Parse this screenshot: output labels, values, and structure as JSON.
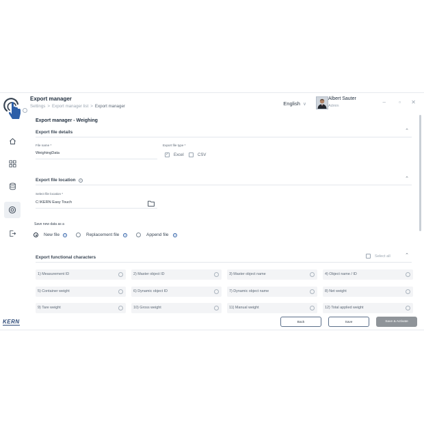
{
  "header": {
    "title": "Export manager",
    "breadcrumbs": [
      "Settings",
      "Export manager list",
      "Export manager"
    ],
    "language": "English",
    "user_name": "Albert Sauter",
    "user_role": "Admin"
  },
  "sidebar": {
    "brand": "KERN",
    "items": [
      "home-icon",
      "grid-icon",
      "database-icon",
      "settings-icon",
      "logout-icon"
    ],
    "active_item": "settings-icon"
  },
  "page": {
    "title": "Export manager - Weighing"
  },
  "file_details": {
    "title": "Export file details",
    "name_label": "File name *",
    "name_value": "WeighingData",
    "type_label": "Export file type *",
    "options": [
      {
        "label": "Excel",
        "checked": true
      },
      {
        "label": "CSV",
        "checked": false
      }
    ]
  },
  "file_location": {
    "title": "Export file location",
    "select_label": "Select file location *",
    "path_value": "C:\\KERN Easy Touch"
  },
  "save_mode": {
    "label": "Save new data as a",
    "options": [
      {
        "label": "New file",
        "selected": true
      },
      {
        "label": "Replacement file",
        "selected": false
      },
      {
        "label": "Append file",
        "selected": false
      }
    ]
  },
  "functional_characters": {
    "title": "Export functional characters",
    "select_all_label": "Select all",
    "items": [
      "1) Measurement ID",
      "2) Master object ID",
      "3) Master object name",
      "4) Object name / ID",
      "5) Container weight",
      "6) Dynamic object ID",
      "7) Dynamic object name",
      "8) Net weight",
      "9) Tare weight",
      "10) Gross weight",
      "11) Manual weight",
      "12) Total applied weight"
    ]
  },
  "actions": {
    "back": "Back",
    "save": "Save",
    "save_activate": "Save & Activate"
  },
  "colors": {
    "primary_text": "#1f2d3d",
    "muted": "#9aa5b1",
    "accent": "#2d5fa8",
    "button_disabled": "#8f9499"
  }
}
